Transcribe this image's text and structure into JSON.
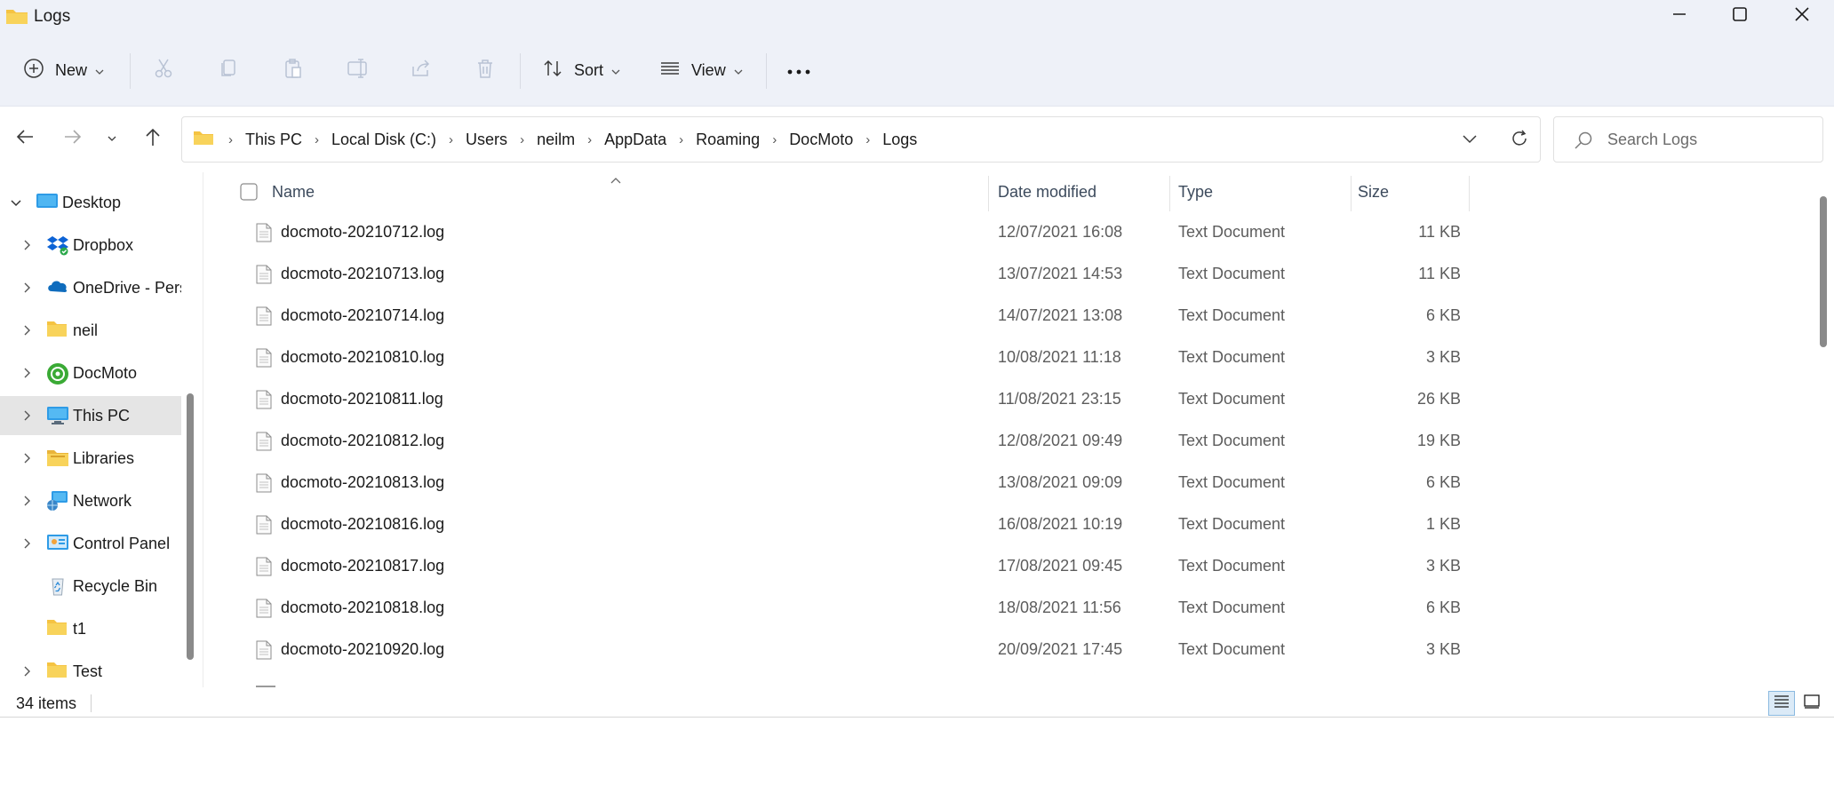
{
  "window": {
    "title": "Logs",
    "controls": {
      "minimize": "minimize",
      "maximize": "maximize",
      "close": "close"
    }
  },
  "toolbar": {
    "new_label": "New",
    "sort_label": "Sort",
    "view_label": "View",
    "icons": [
      "cut-icon",
      "copy-icon",
      "paste-icon",
      "rename-icon",
      "share-icon",
      "delete-icon",
      "more-icon"
    ]
  },
  "address": {
    "crumbs": [
      "This PC",
      "Local Disk (C:)",
      "Users",
      "neilm",
      "AppData",
      "Roaming",
      "DocMoto",
      "Logs"
    ],
    "search_placeholder": "Search Logs"
  },
  "nav": {
    "items": [
      {
        "label": "Desktop",
        "icon": "desktop-icon",
        "expanded": true,
        "has_children": true,
        "level": 0
      },
      {
        "label": "Dropbox",
        "icon": "dropbox-icon",
        "has_children": true,
        "level": 1
      },
      {
        "label": "OneDrive - Pers",
        "icon": "onedrive-icon",
        "has_children": true,
        "level": 1
      },
      {
        "label": "neil",
        "icon": "folder-icon",
        "has_children": true,
        "level": 1
      },
      {
        "label": "DocMoto",
        "icon": "docmoto-icon",
        "has_children": true,
        "level": 1
      },
      {
        "label": "This PC",
        "icon": "pc-icon",
        "has_children": true,
        "level": 1,
        "selected": true
      },
      {
        "label": "Libraries",
        "icon": "libraries-icon",
        "has_children": true,
        "level": 1
      },
      {
        "label": "Network",
        "icon": "network-icon",
        "has_children": true,
        "level": 1
      },
      {
        "label": "Control Panel",
        "icon": "control-panel-icon",
        "has_children": true,
        "level": 1
      },
      {
        "label": "Recycle Bin",
        "icon": "recycle-bin-icon",
        "has_children": false,
        "level": 1
      },
      {
        "label": "t1",
        "icon": "folder-icon",
        "has_children": false,
        "level": 1
      },
      {
        "label": "Test",
        "icon": "folder-icon",
        "has_children": true,
        "level": 1
      }
    ]
  },
  "columns": {
    "name": "Name",
    "date": "Date modified",
    "type": "Type",
    "size": "Size"
  },
  "files": [
    {
      "name": "docmoto-20210712.log",
      "date": "12/07/2021 16:08",
      "type": "Text Document",
      "size": "11 KB"
    },
    {
      "name": "docmoto-20210713.log",
      "date": "13/07/2021 14:53",
      "type": "Text Document",
      "size": "11 KB"
    },
    {
      "name": "docmoto-20210714.log",
      "date": "14/07/2021 13:08",
      "type": "Text Document",
      "size": "6 KB"
    },
    {
      "name": "docmoto-20210810.log",
      "date": "10/08/2021 11:18",
      "type": "Text Document",
      "size": "3 KB"
    },
    {
      "name": "docmoto-20210811.log",
      "date": "11/08/2021 23:15",
      "type": "Text Document",
      "size": "26 KB"
    },
    {
      "name": "docmoto-20210812.log",
      "date": "12/08/2021 09:49",
      "type": "Text Document",
      "size": "19 KB"
    },
    {
      "name": "docmoto-20210813.log",
      "date": "13/08/2021 09:09",
      "type": "Text Document",
      "size": "6 KB"
    },
    {
      "name": "docmoto-20210816.log",
      "date": "16/08/2021 10:19",
      "type": "Text Document",
      "size": "1 KB"
    },
    {
      "name": "docmoto-20210817.log",
      "date": "17/08/2021 09:45",
      "type": "Text Document",
      "size": "3 KB"
    },
    {
      "name": "docmoto-20210818.log",
      "date": "18/08/2021 11:56",
      "type": "Text Document",
      "size": "6 KB"
    },
    {
      "name": "docmoto-20210920.log",
      "date": "20/09/2021 17:45",
      "type": "Text Document",
      "size": "3 KB"
    }
  ],
  "status": {
    "item_count": "34 items"
  },
  "colors": {
    "accent": "#0067c0",
    "folder": "#f5c342",
    "chrome": "#eef1f8"
  }
}
